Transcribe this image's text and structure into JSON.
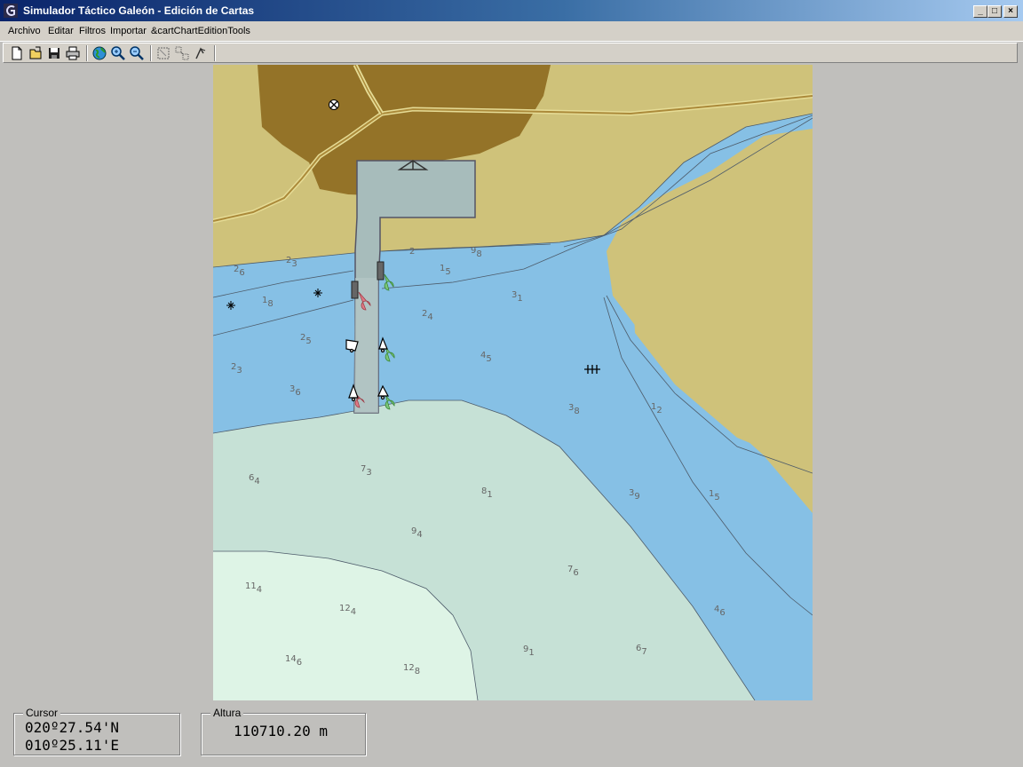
{
  "window": {
    "title": "Simulador Táctico Galeón - Edición de Cartas",
    "controls": {
      "minimize": "_",
      "maximize": "□",
      "close": "×"
    }
  },
  "menu": {
    "items": [
      "Archivo",
      "Editar",
      "Filtros",
      "Importar",
      "&cartChartEditionTools"
    ]
  },
  "toolbar": {
    "buttons": [
      "new-document-icon",
      "open-folder-icon",
      "save-icon",
      "print-icon",
      "globe-icon",
      "zoom-in-icon",
      "zoom-out-icon",
      "select-area-icon",
      "object-select-icon",
      "edit-tool-icon"
    ]
  },
  "chart": {
    "colors": {
      "land": "#cfc27a",
      "land_dark": "#947328",
      "water_deep": "#86c0e5",
      "shallow": "#c6e1d6",
      "very_shallow": "#def4e6",
      "pier": "#a7bcbb"
    },
    "soundings": [
      {
        "v": "2",
        "s": "6"
      },
      {
        "v": "2",
        "s": "3"
      },
      {
        "v": "1",
        "s": "8"
      },
      {
        "v": "2",
        "s": "5"
      },
      {
        "v": "2",
        "s": "3"
      },
      {
        "v": "3",
        "s": "6"
      },
      {
        "v": "1",
        "s": "5"
      },
      {
        "v": "2",
        "s": "4"
      },
      {
        "v": "3",
        "s": "1"
      },
      {
        "v": "4",
        "s": "5"
      },
      {
        "v": "3",
        "s": "8"
      },
      {
        "v": "1",
        "s": "2"
      },
      {
        "v": "6",
        "s": "4"
      },
      {
        "v": "7",
        "s": "3"
      },
      {
        "v": "8",
        "s": "1"
      },
      {
        "v": "3",
        "s": "9"
      },
      {
        "v": "1",
        "s": "5"
      },
      {
        "v": "9",
        "s": "4"
      },
      {
        "v": "11",
        "s": "4"
      },
      {
        "v": "12",
        "s": "4"
      },
      {
        "v": "7",
        "s": "6"
      },
      {
        "v": "4",
        "s": "6"
      },
      {
        "v": "14",
        "s": "6"
      },
      {
        "v": "12",
        "s": "8"
      },
      {
        "v": "9",
        "s": "1"
      },
      {
        "v": "6",
        "s": "7"
      },
      {
        "v": "2",
        "s": ""
      },
      {
        "v": "9",
        "s": "8"
      }
    ]
  },
  "status": {
    "cursor_label": "Cursor",
    "cursor_lat": "020º27.54'N",
    "cursor_lon": "010º25.11'E",
    "altura_label": "Altura",
    "altura_value": "110710.20 m"
  }
}
